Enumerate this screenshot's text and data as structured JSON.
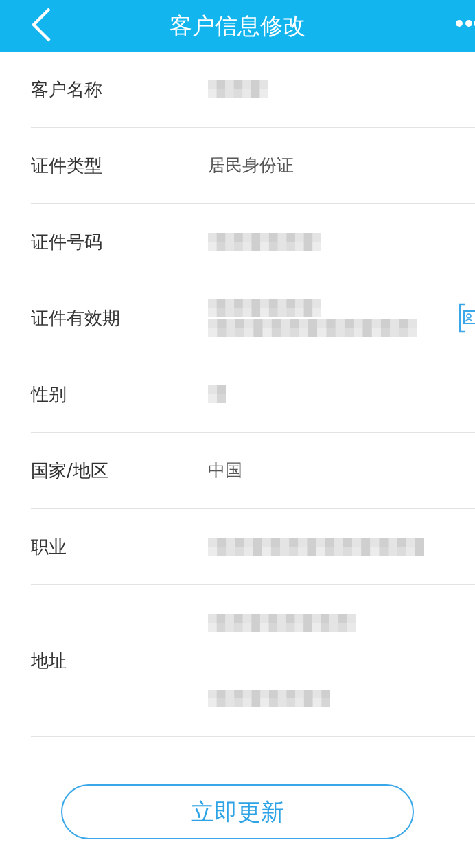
{
  "header": {
    "title": "客户信息修改"
  },
  "rows": [
    {
      "label": "客户名称",
      "values": [
        {
          "kind": "short"
        }
      ]
    },
    {
      "label": "证件类型",
      "values": [
        {
          "kind": "text",
          "text": "居民身份证"
        }
      ]
    },
    {
      "label": "证件号码",
      "values": [
        {
          "kind": "medium"
        }
      ]
    },
    {
      "label": "证件有效期",
      "values": [
        {
          "kind": "medium"
        },
        {
          "kind": "long"
        }
      ],
      "scan_button": true
    },
    {
      "label": "性别",
      "values": [
        {
          "kind": "tiny"
        }
      ]
    },
    {
      "label": "国家/地区",
      "values": [
        {
          "kind": "text",
          "text": "中国"
        }
      ]
    },
    {
      "label": "职业",
      "values": [
        {
          "kind": "xlong"
        }
      ]
    },
    {
      "label": "地址",
      "values": [
        {
          "kind": "wide"
        },
        {
          "kind": "wideish"
        }
      ],
      "split": true
    }
  ],
  "submit": {
    "label": "立即更新"
  }
}
